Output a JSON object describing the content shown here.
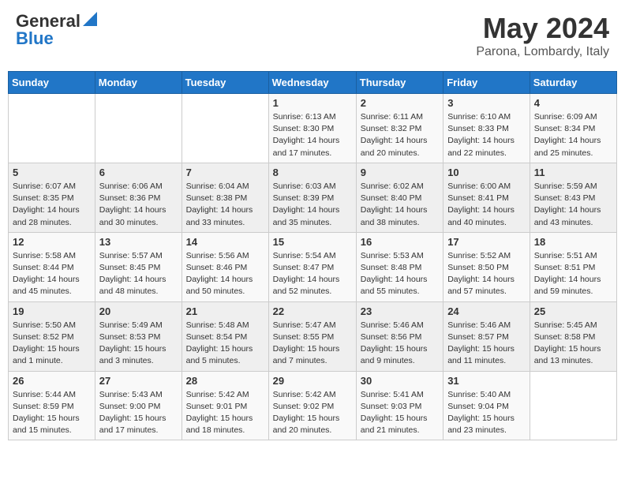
{
  "header": {
    "logo_general": "General",
    "logo_blue": "Blue",
    "title": "May 2024",
    "location": "Parona, Lombardy, Italy"
  },
  "days_of_week": [
    "Sunday",
    "Monday",
    "Tuesday",
    "Wednesday",
    "Thursday",
    "Friday",
    "Saturday"
  ],
  "weeks": [
    [
      {
        "day": "",
        "info": ""
      },
      {
        "day": "",
        "info": ""
      },
      {
        "day": "",
        "info": ""
      },
      {
        "day": "1",
        "info": "Sunrise: 6:13 AM\nSunset: 8:30 PM\nDaylight: 14 hours and 17 minutes."
      },
      {
        "day": "2",
        "info": "Sunrise: 6:11 AM\nSunset: 8:32 PM\nDaylight: 14 hours and 20 minutes."
      },
      {
        "day": "3",
        "info": "Sunrise: 6:10 AM\nSunset: 8:33 PM\nDaylight: 14 hours and 22 minutes."
      },
      {
        "day": "4",
        "info": "Sunrise: 6:09 AM\nSunset: 8:34 PM\nDaylight: 14 hours and 25 minutes."
      }
    ],
    [
      {
        "day": "5",
        "info": "Sunrise: 6:07 AM\nSunset: 8:35 PM\nDaylight: 14 hours and 28 minutes."
      },
      {
        "day": "6",
        "info": "Sunrise: 6:06 AM\nSunset: 8:36 PM\nDaylight: 14 hours and 30 minutes."
      },
      {
        "day": "7",
        "info": "Sunrise: 6:04 AM\nSunset: 8:38 PM\nDaylight: 14 hours and 33 minutes."
      },
      {
        "day": "8",
        "info": "Sunrise: 6:03 AM\nSunset: 8:39 PM\nDaylight: 14 hours and 35 minutes."
      },
      {
        "day": "9",
        "info": "Sunrise: 6:02 AM\nSunset: 8:40 PM\nDaylight: 14 hours and 38 minutes."
      },
      {
        "day": "10",
        "info": "Sunrise: 6:00 AM\nSunset: 8:41 PM\nDaylight: 14 hours and 40 minutes."
      },
      {
        "day": "11",
        "info": "Sunrise: 5:59 AM\nSunset: 8:43 PM\nDaylight: 14 hours and 43 minutes."
      }
    ],
    [
      {
        "day": "12",
        "info": "Sunrise: 5:58 AM\nSunset: 8:44 PM\nDaylight: 14 hours and 45 minutes."
      },
      {
        "day": "13",
        "info": "Sunrise: 5:57 AM\nSunset: 8:45 PM\nDaylight: 14 hours and 48 minutes."
      },
      {
        "day": "14",
        "info": "Sunrise: 5:56 AM\nSunset: 8:46 PM\nDaylight: 14 hours and 50 minutes."
      },
      {
        "day": "15",
        "info": "Sunrise: 5:54 AM\nSunset: 8:47 PM\nDaylight: 14 hours and 52 minutes."
      },
      {
        "day": "16",
        "info": "Sunrise: 5:53 AM\nSunset: 8:48 PM\nDaylight: 14 hours and 55 minutes."
      },
      {
        "day": "17",
        "info": "Sunrise: 5:52 AM\nSunset: 8:50 PM\nDaylight: 14 hours and 57 minutes."
      },
      {
        "day": "18",
        "info": "Sunrise: 5:51 AM\nSunset: 8:51 PM\nDaylight: 14 hours and 59 minutes."
      }
    ],
    [
      {
        "day": "19",
        "info": "Sunrise: 5:50 AM\nSunset: 8:52 PM\nDaylight: 15 hours and 1 minute."
      },
      {
        "day": "20",
        "info": "Sunrise: 5:49 AM\nSunset: 8:53 PM\nDaylight: 15 hours and 3 minutes."
      },
      {
        "day": "21",
        "info": "Sunrise: 5:48 AM\nSunset: 8:54 PM\nDaylight: 15 hours and 5 minutes."
      },
      {
        "day": "22",
        "info": "Sunrise: 5:47 AM\nSunset: 8:55 PM\nDaylight: 15 hours and 7 minutes."
      },
      {
        "day": "23",
        "info": "Sunrise: 5:46 AM\nSunset: 8:56 PM\nDaylight: 15 hours and 9 minutes."
      },
      {
        "day": "24",
        "info": "Sunrise: 5:46 AM\nSunset: 8:57 PM\nDaylight: 15 hours and 11 minutes."
      },
      {
        "day": "25",
        "info": "Sunrise: 5:45 AM\nSunset: 8:58 PM\nDaylight: 15 hours and 13 minutes."
      }
    ],
    [
      {
        "day": "26",
        "info": "Sunrise: 5:44 AM\nSunset: 8:59 PM\nDaylight: 15 hours and 15 minutes."
      },
      {
        "day": "27",
        "info": "Sunrise: 5:43 AM\nSunset: 9:00 PM\nDaylight: 15 hours and 17 minutes."
      },
      {
        "day": "28",
        "info": "Sunrise: 5:42 AM\nSunset: 9:01 PM\nDaylight: 15 hours and 18 minutes."
      },
      {
        "day": "29",
        "info": "Sunrise: 5:42 AM\nSunset: 9:02 PM\nDaylight: 15 hours and 20 minutes."
      },
      {
        "day": "30",
        "info": "Sunrise: 5:41 AM\nSunset: 9:03 PM\nDaylight: 15 hours and 21 minutes."
      },
      {
        "day": "31",
        "info": "Sunrise: 5:40 AM\nSunset: 9:04 PM\nDaylight: 15 hours and 23 minutes."
      },
      {
        "day": "",
        "info": ""
      }
    ]
  ]
}
